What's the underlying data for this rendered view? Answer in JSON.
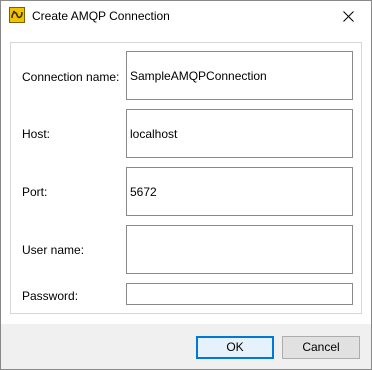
{
  "window": {
    "title": "Create AMQP Connection",
    "icon": "amqp-app-icon",
    "close_icon": "close-icon"
  },
  "form": {
    "connection_name": {
      "label": "Connection name:",
      "value": "SampleAMQPConnection"
    },
    "host": {
      "label": "Host:",
      "value": "localhost"
    },
    "port": {
      "label": "Port:",
      "value": "5672"
    },
    "user_name": {
      "label": "User name:",
      "value": ""
    },
    "password": {
      "label": "Password:",
      "value": ""
    }
  },
  "buttons": {
    "ok": "OK",
    "cancel": "Cancel"
  },
  "colors": {
    "default_button_border": "#0078d7",
    "footer_background": "#f0f0f0",
    "icon_background": "#f2c200"
  }
}
